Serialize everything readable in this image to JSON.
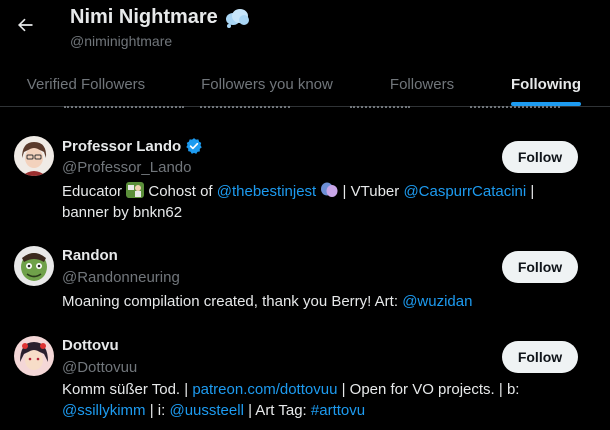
{
  "header": {
    "title": "Nimi Nightmare",
    "handle": "@niminightmare"
  },
  "tabs": [
    {
      "label": "Verified Followers",
      "active": false
    },
    {
      "label": "Followers you know",
      "active": false
    },
    {
      "label": "Followers",
      "active": false
    },
    {
      "label": "Following",
      "active": true
    }
  ],
  "users": [
    {
      "name": "Professor Lando",
      "verified": true,
      "handle": "@Professor_Lando",
      "follow_label": "Follow",
      "bio": {
        "t1": "Educator ",
        "t2": " Cohost of ",
        "link1": "@thebestinjest",
        "t3": " | VTuber ",
        "link2": "@CaspurrCatacini",
        "t4": " |",
        "line2": "banner by bnkn62"
      }
    },
    {
      "name": "Randon",
      "verified": false,
      "handle": "@Randonneuring",
      "follow_label": "Follow",
      "bio": {
        "t1": "Moaning compilation created, thank you Berry! Art: ",
        "link1": "@wuzidan"
      }
    },
    {
      "name": "Dottovu",
      "verified": false,
      "handle": "@Dottovuu",
      "follow_label": "Follow",
      "bio": {
        "t1": "Komm süßer Tod. | ",
        "link1": "patreon.com/dottovuu",
        "t2": " | Open for VO projects. | b:",
        "link2": "@ssillykimm",
        "t3": " | i: ",
        "link3": "@uussteell",
        "t4": " | Art Tag: ",
        "link4": "#arttovu"
      }
    }
  ],
  "colors": {
    "accent": "#1d9bf0",
    "background": "#000000",
    "muted": "#71767b",
    "button_bg": "#eff3f4"
  },
  "icons": [
    "back-arrow-icon",
    "cloud-emoji-icon",
    "verified-badge-icon",
    "teacher-emoji-icon",
    "theater-masks-emoji-icon"
  ]
}
